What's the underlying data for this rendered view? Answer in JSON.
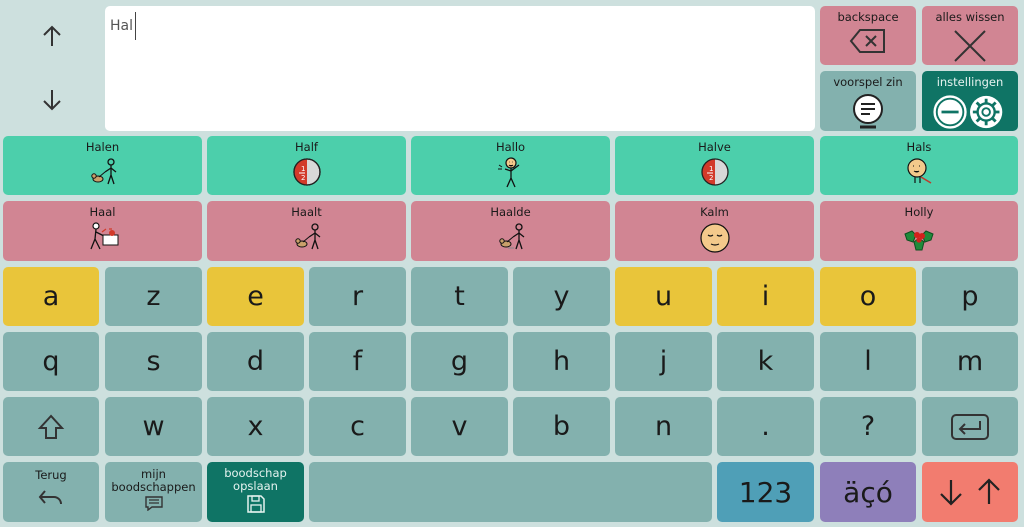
{
  "text_field": {
    "value": "Hal"
  },
  "controls": {
    "backspace": "backspace",
    "clear_all": "alles wissen",
    "predict_sentence": "voorspel zin",
    "settings": "instellingen"
  },
  "suggestions_row1": [
    {
      "label": "Halen",
      "icon": "person-dog-icon"
    },
    {
      "label": "Half",
      "icon": "half-circle-icon"
    },
    {
      "label": "Hallo",
      "icon": "waving-person-icon"
    },
    {
      "label": "Halve",
      "icon": "half-circle-icon"
    },
    {
      "label": "Hals",
      "icon": "neck-icon"
    }
  ],
  "suggestions_row2": [
    {
      "label": "Haal",
      "icon": "person-fetch-icon"
    },
    {
      "label": "Haalt",
      "icon": "person-dog-icon"
    },
    {
      "label": "Haalde",
      "icon": "person-dog-icon"
    },
    {
      "label": "Kalm",
      "icon": "calm-face-icon"
    },
    {
      "label": "Holly",
      "icon": "holly-icon"
    }
  ],
  "keys": {
    "row1": [
      "a",
      "z",
      "e",
      "r",
      "t",
      "y",
      "u",
      "i",
      "o",
      "p"
    ],
    "row2": [
      "q",
      "s",
      "d",
      "f",
      "g",
      "h",
      "j",
      "k",
      "l",
      "m"
    ],
    "row3": [
      "w",
      "x",
      "c",
      "v",
      "b",
      "n",
      ".",
      "?"
    ]
  },
  "bottom": {
    "back": "Terug",
    "my_messages": "mijn boodschappen",
    "save_message": "boodschap opslaan",
    "numbers": "123",
    "accents": "äçó"
  },
  "colors": {
    "background": "#cde0de",
    "teal": "#83b1ae",
    "yellow": "#e9c53a",
    "green": "#4ccfab",
    "pink": "#d18593",
    "dark_green": "#0f7465",
    "blue": "#4f9fb7",
    "purple": "#8e7fba",
    "coral": "#f27c6f"
  }
}
